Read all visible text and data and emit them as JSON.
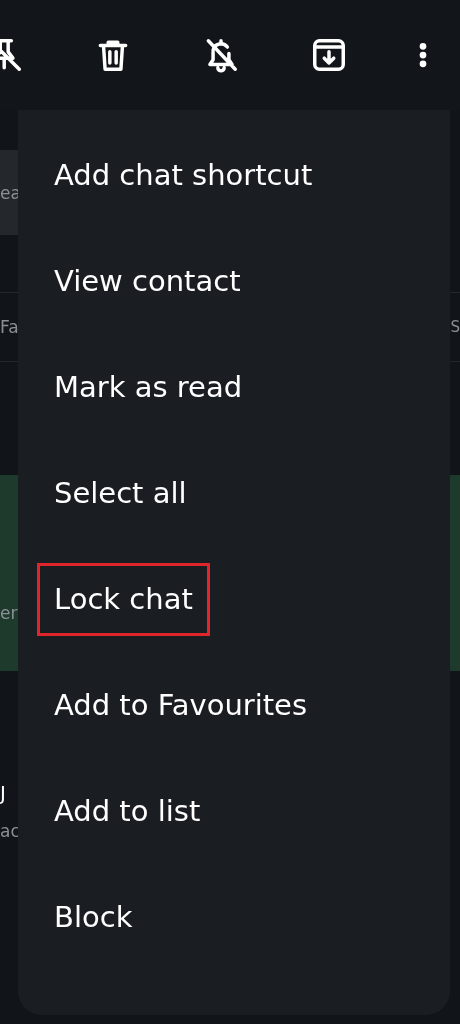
{
  "toolbar": {
    "icons": [
      {
        "kind": "unpin"
      },
      {
        "kind": "delete"
      },
      {
        "kind": "mute"
      },
      {
        "kind": "archive"
      },
      {
        "kind": "more"
      }
    ]
  },
  "search": {
    "placeholder": "ea"
  },
  "filters": [
    {
      "label": "Fa"
    },
    {
      "label": "S"
    }
  ],
  "chats": [
    {
      "selected": true,
      "preview": "er"
    },
    {
      "selected": false,
      "name": "J",
      "preview": "ac"
    }
  ],
  "menu": {
    "items": [
      {
        "label": "Add chat shortcut",
        "annotated": false
      },
      {
        "label": "View contact",
        "annotated": false
      },
      {
        "label": "Mark as read",
        "annotated": false
      },
      {
        "label": "Select all",
        "annotated": false
      },
      {
        "label": "Lock chat",
        "annotated": true
      },
      {
        "label": "Add to Favourites",
        "annotated": false
      },
      {
        "label": "Add to list",
        "annotated": false
      },
      {
        "label": "Block",
        "annotated": false
      }
    ]
  }
}
